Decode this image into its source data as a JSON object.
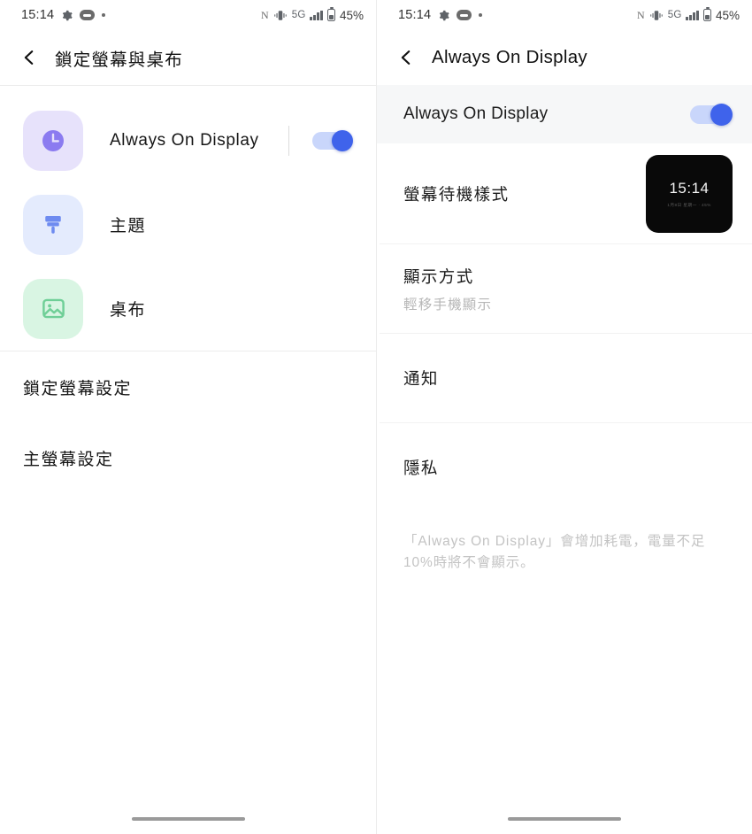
{
  "status_bar": {
    "time": "15:14",
    "left_icons": [
      "gear-icon",
      "capsule-icon",
      "dot-icon"
    ],
    "carrier_glyph": "N",
    "network_label": "5G",
    "battery_percent": "45%",
    "right_icons": [
      "vibrate-icon",
      "signal-bars-icon",
      "battery-icon"
    ]
  },
  "left_panel": {
    "header": {
      "title": "鎖定螢幕與桌布",
      "back_icon": "chevron-left-icon"
    },
    "tiles": [
      {
        "label": "Always On Display",
        "icon": "clock-icon",
        "tile_color": "#e7e2fb",
        "has_toggle": true,
        "toggle_on": true
      },
      {
        "label": "主題",
        "icon": "paintbrush-icon",
        "tile_color": "#e4ebfd",
        "has_toggle": false,
        "toggle_on": false
      },
      {
        "label": "桌布",
        "icon": "image-icon",
        "tile_color": "#d9f5e3",
        "has_toggle": false,
        "toggle_on": false
      }
    ],
    "text_rows": [
      {
        "label": "鎖定螢幕設定"
      },
      {
        "label": "主螢幕設定"
      }
    ]
  },
  "right_panel": {
    "header": {
      "title": "Always On Display",
      "back_icon": "chevron-left-icon"
    },
    "master_switch": {
      "label": "Always On Display",
      "on": true
    },
    "rows": [
      {
        "title": "螢幕待機樣式",
        "subtitle": "",
        "has_preview": true
      },
      {
        "title": "顯示方式",
        "subtitle": "輕移手機顯示",
        "has_preview": false
      },
      {
        "title": "通知",
        "subtitle": "",
        "has_preview": false
      },
      {
        "title": "隱私",
        "subtitle": "",
        "has_preview": false
      }
    ],
    "preview": {
      "time": "15:14",
      "sub": "1月8日 星期一 · 45%"
    },
    "note": "「Always On Display」會增加耗電，電量不足10%時將不會顯示。"
  },
  "colors": {
    "accent": "#3f63eb",
    "accent_track": "#c9d6fb",
    "row_highlight": "#f6f7f8",
    "divider": "#ececec",
    "muted_text": "#b6b6b6"
  },
  "gesture_bar": {
    "present": true
  }
}
